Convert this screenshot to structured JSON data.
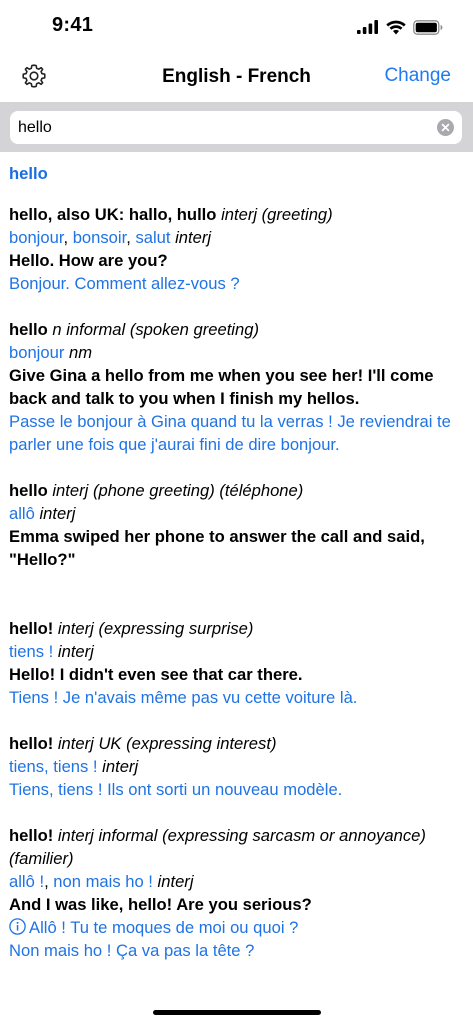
{
  "status": {
    "time": "9:41"
  },
  "nav": {
    "title": "English - French",
    "change_label": "Change"
  },
  "search": {
    "value": "hello"
  },
  "headword": "hello",
  "entries": [
    {
      "head": "hello, also UK: hallo, hullo",
      "gram": "interj",
      "sense": "(greeting)",
      "translations": [
        "bonjour",
        "bonsoir",
        "salut"
      ],
      "trans_gram": "interj",
      "example_en": "Hello. How are you?",
      "example_fr": "Bonjour. Comment allez-vous ?"
    },
    {
      "head": "hello",
      "gram": "n informal",
      "sense": "(spoken greeting)",
      "translation": "bonjour",
      "trans_gram": "nm",
      "example_en": "Give Gina a hello from me when you see her! I'll come back and talk to you when I finish my hellos.",
      "example_fr": "Passe le bonjour à Gina quand tu la verras ! Je reviendrai te parler une fois que j'aurai fini de dire bonjour."
    },
    {
      "head": "hello",
      "gram": "interj",
      "sense": "(phone greeting) (téléphone)",
      "translation": "allô",
      "trans_gram": "interj",
      "example_en": "Emma swiped her phone to answer the call and said, \"Hello?\""
    },
    {
      "head": "hello!",
      "gram": "interj",
      "sense": "(expressing surprise)",
      "translation": "tiens !",
      "trans_gram": "interj",
      "example_en": "Hello! I didn't even see that car there.",
      "example_fr": "Tiens ! Je n'avais même pas vu cette voiture là."
    },
    {
      "head": "hello!",
      "gram": "interj UK",
      "sense": "(expressing interest)",
      "translation": "tiens, tiens !",
      "trans_gram": "interj",
      "example_fr": "Tiens, tiens ! Ils ont sorti un nouveau modèle."
    },
    {
      "head": "hello!",
      "gram": "interj informal",
      "sense": "(expressing sarcasm or annoyance) (familier)",
      "translations": [
        "allô !",
        "non mais ho !"
      ],
      "trans_gram": "interj",
      "example_en": "And I was like, hello! Are you serious?",
      "example_fr_1": "Allô ! Tu te moques de moi ou quoi ?",
      "example_fr_2": "Non mais ho ! Ça va pas la tête ?"
    }
  ]
}
